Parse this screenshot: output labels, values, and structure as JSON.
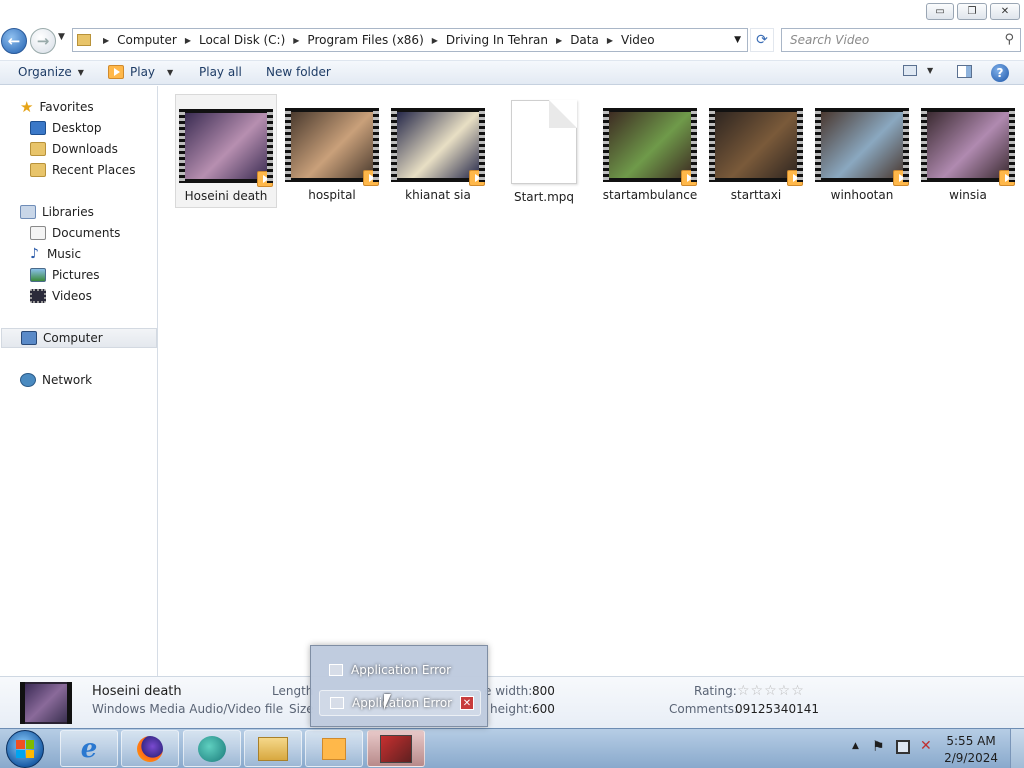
{
  "window": {
    "minimize": "▭",
    "restore": "❐",
    "close": "✕"
  },
  "address": {
    "crumbs": [
      "Computer",
      "Local Disk (C:)",
      "Program Files (x86)",
      "Driving In Tehran",
      "Data",
      "Video"
    ]
  },
  "search": {
    "placeholder": "Search Video"
  },
  "toolbar": {
    "organize": "Organize",
    "play": "Play",
    "play_all": "Play all",
    "new_folder": "New folder",
    "help": "?"
  },
  "sidebar": {
    "favorites": "Favorites",
    "desktop": "Desktop",
    "downloads": "Downloads",
    "recent": "Recent Places",
    "libraries": "Libraries",
    "documents": "Documents",
    "music": "Music",
    "pictures": "Pictures",
    "videos": "Videos",
    "computer": "Computer",
    "network": "Network"
  },
  "files": [
    {
      "name": "Hoseini death",
      "kind": "video",
      "colors": [
        "#3a2c52",
        "#b78fb0"
      ]
    },
    {
      "name": "hospital",
      "kind": "video",
      "colors": [
        "#4a3a2e",
        "#c9a07a"
      ]
    },
    {
      "name": "khianat sia",
      "kind": "video",
      "colors": [
        "#25284a",
        "#e8dfc4"
      ]
    },
    {
      "name": "Start.mpq",
      "kind": "file",
      "colors": [
        "#ffffff",
        "#ffffff"
      ]
    },
    {
      "name": "startambulance",
      "kind": "video",
      "colors": [
        "#3d2b22",
        "#6f9a4a"
      ]
    },
    {
      "name": "starttaxi",
      "kind": "video",
      "colors": [
        "#2e2520",
        "#7a5a3a"
      ]
    },
    {
      "name": "winhootan",
      "kind": "video",
      "colors": [
        "#4a3830",
        "#8aa8c0"
      ]
    },
    {
      "name": "winsia",
      "kind": "video",
      "colors": [
        "#3a2a30",
        "#b08ab0"
      ]
    }
  ],
  "details": {
    "name": "Hoseini death",
    "type": "Windows Media Audio/Video file",
    "length_label": "Length",
    "size_label": "Size",
    "width_label": "e width:",
    "width_value": "800",
    "height_label": "height:",
    "height_value": "600",
    "rating_label": "Rating:",
    "stars": "☆☆☆☆☆",
    "comments_label": "Comments:",
    "comments_value": "09125340141"
  },
  "popup": {
    "items": [
      "Application Error",
      "Application Error"
    ],
    "close": "✕"
  },
  "clock": {
    "time": "5:55 AM",
    "date": "2/9/2024"
  }
}
